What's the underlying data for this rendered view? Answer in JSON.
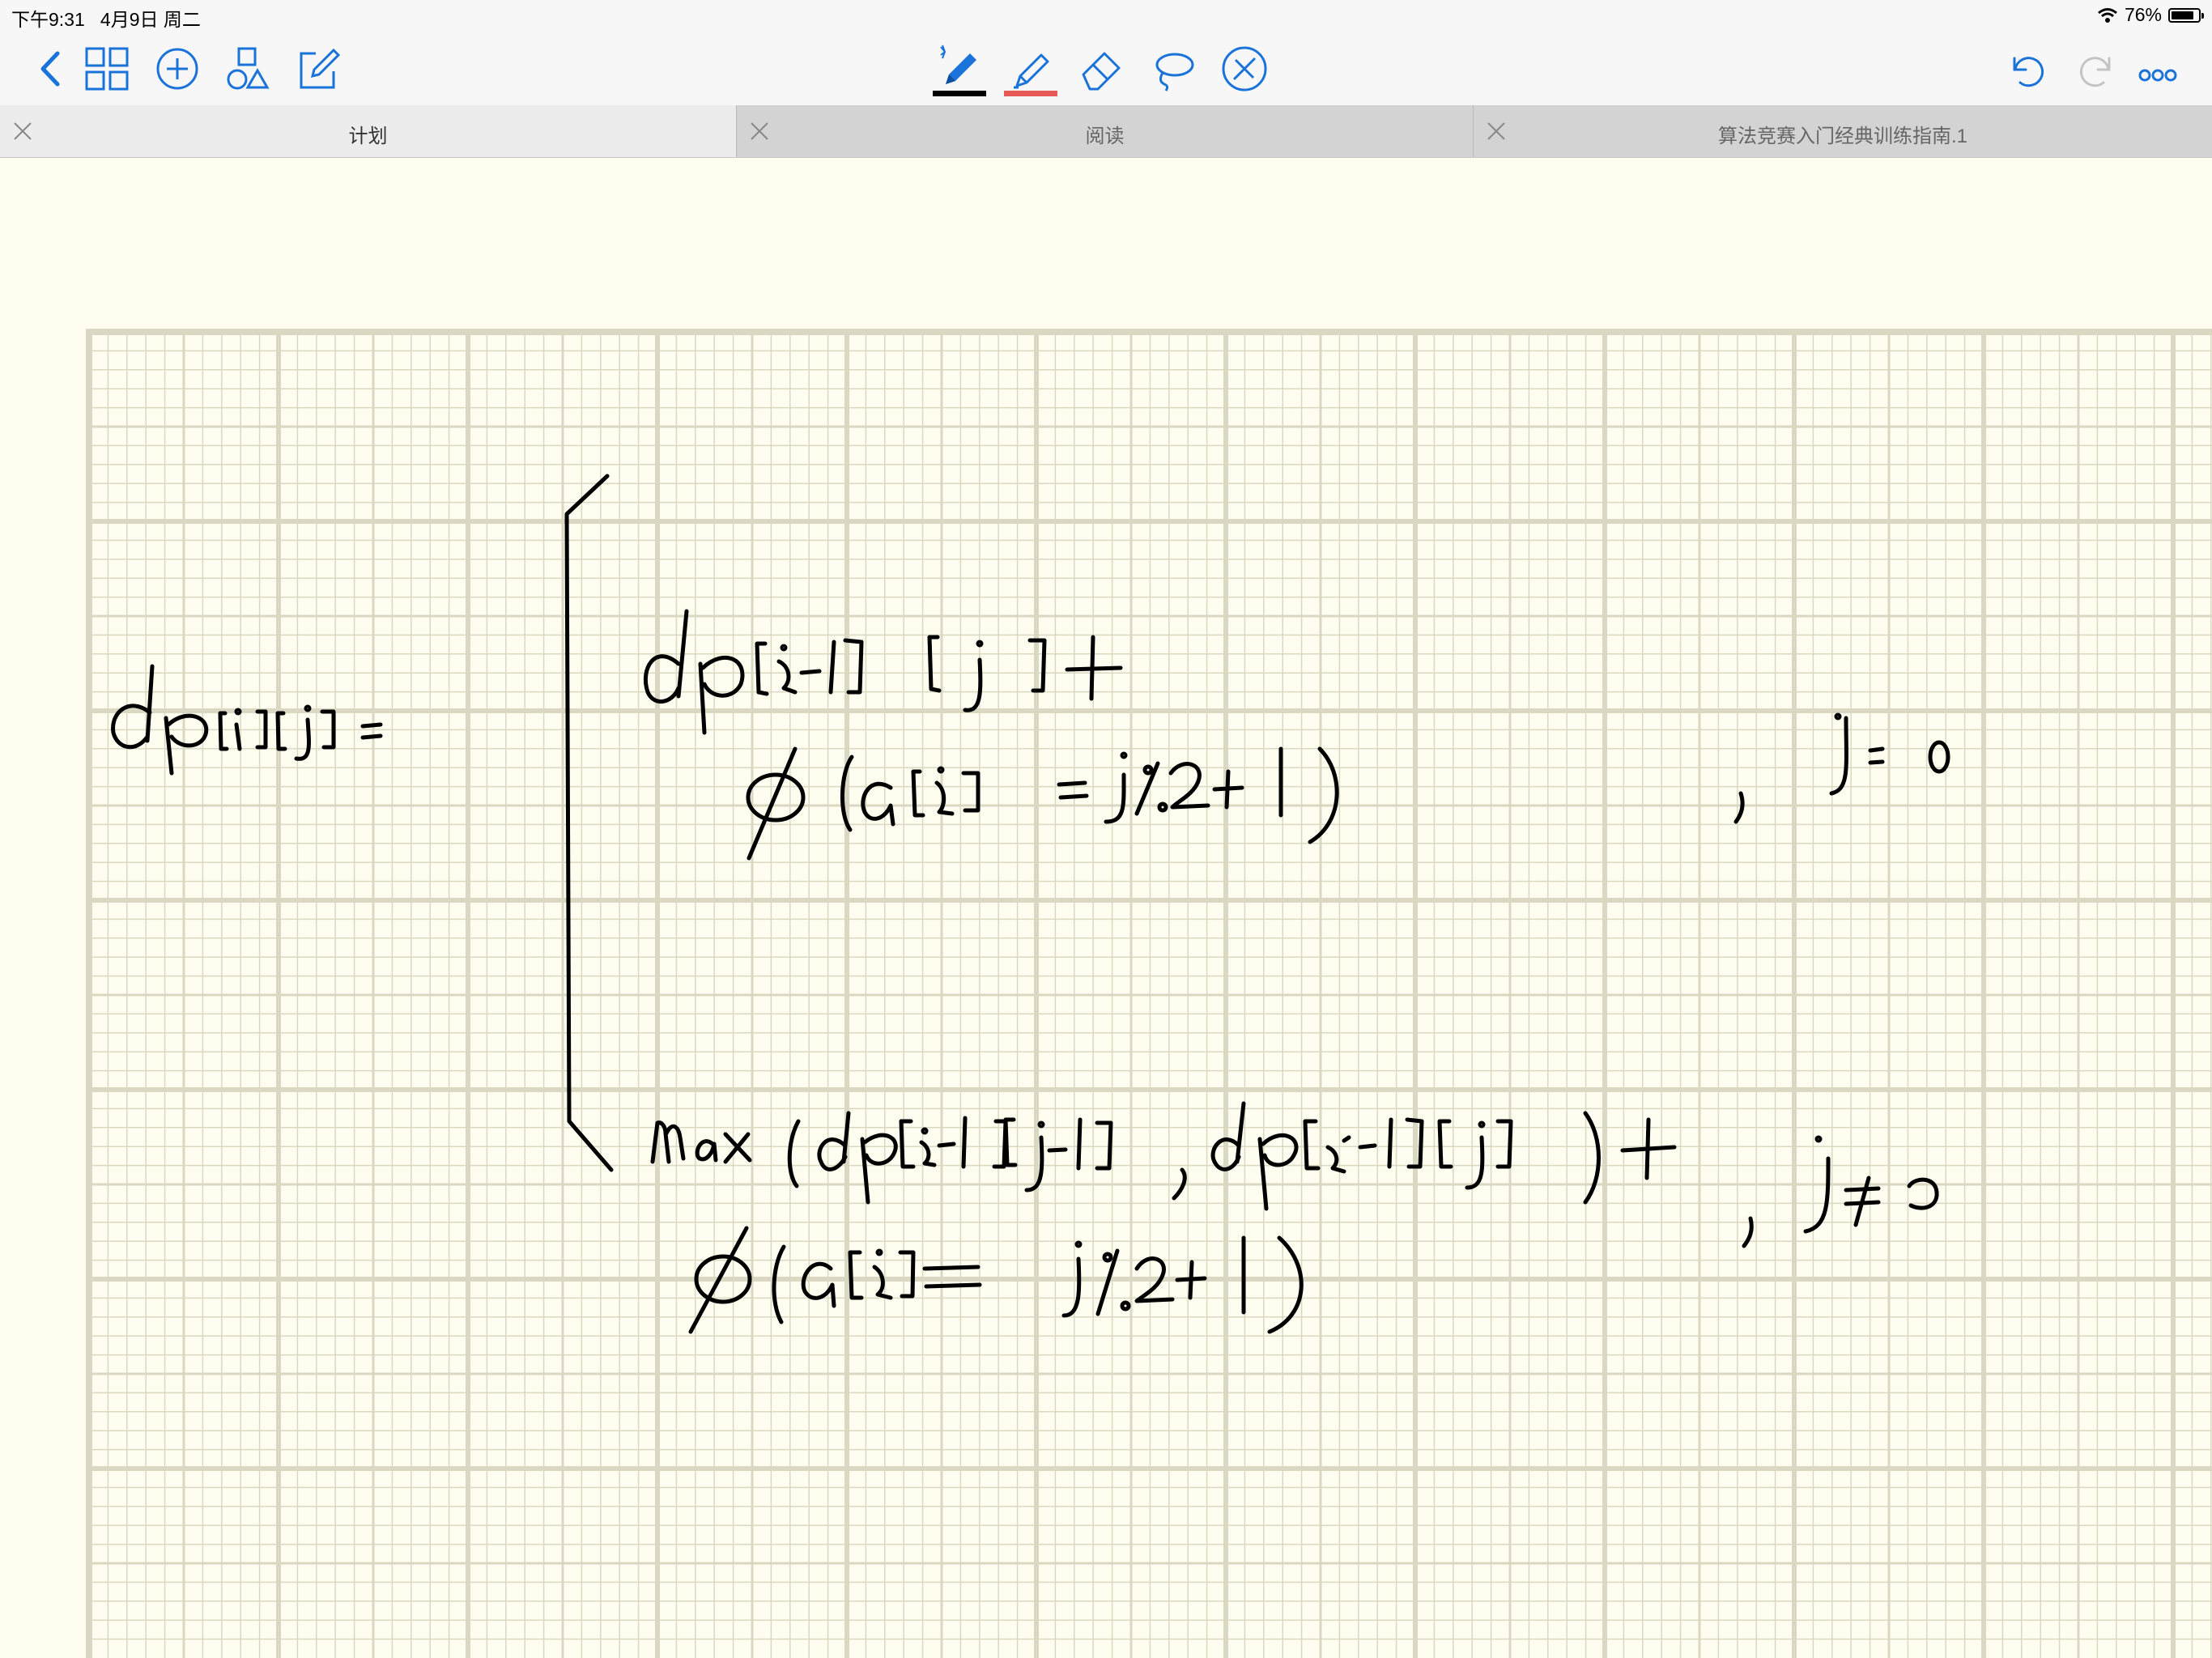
{
  "status_bar": {
    "time_date": "下午9:31   4月9日 周二",
    "battery": "76%",
    "battery_level": 0.76
  },
  "toolbar": {
    "left_icons": [
      "back-icon",
      "grid-icon",
      "add-icon",
      "shapes-icon",
      "edit-icon"
    ],
    "center_icons": [
      "pen-icon",
      "highlighter-icon",
      "eraser-icon",
      "lasso-icon",
      "bluetooth-pen-icon"
    ],
    "right_icons": [
      "undo-icon",
      "redo-icon",
      "more-icon"
    ],
    "pen_color": "#000000",
    "highlighter_color": "#e85a55",
    "accent_color": "#1a73d9"
  },
  "tabs": [
    {
      "label": "计划",
      "active": true
    },
    {
      "label": "阅读",
      "active": false
    },
    {
      "label": "算法竞赛入门经典训练指南.1",
      "active": false
    }
  ],
  "note": {
    "paper": "graph",
    "paper_color": "#fefdef",
    "grid_color": "#dad7c2",
    "handwriting": [
      "dp[i][j] =",
      "dp[i-1][j]+",
      "φ(a[i]=j%2+1)",
      ", j=0",
      "max(dp[i-1][j-1], dp[i-1][j])+",
      "φ(a[i]=j%2+1)",
      ", j≠0"
    ]
  }
}
